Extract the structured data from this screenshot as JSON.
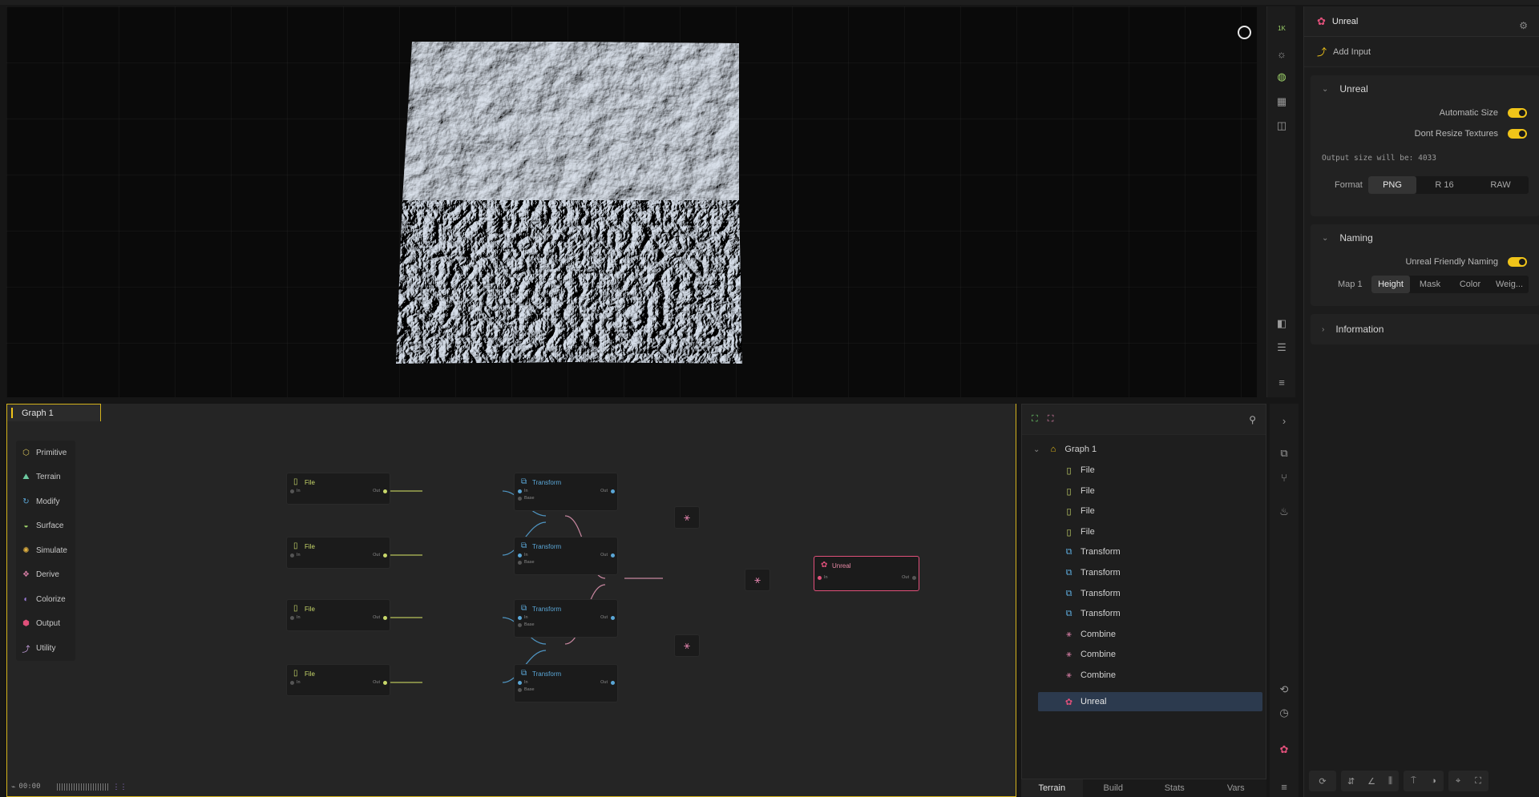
{
  "viewport": {
    "resolution_badge": "1K"
  },
  "right_panel": {
    "title": "Unreal",
    "add_input": "Add Input",
    "unreal_section": {
      "title": "Unreal",
      "automatic_size": "Automatic Size",
      "dont_resize": "Dont Resize Textures",
      "output_size": "Output size will be: 4033",
      "format_label": "Format",
      "formats": [
        "PNG",
        "R 16",
        "RAW"
      ],
      "selected_format": "PNG"
    },
    "naming_section": {
      "title": "Naming",
      "friendly": "Unreal Friendly Naming",
      "map_label": "Map 1",
      "maps": [
        "Height",
        "Mask",
        "Color",
        "Weig..."
      ],
      "selected_map": "Height"
    },
    "information": "Information"
  },
  "graph": {
    "tab": "Graph 1",
    "palette": [
      "Primitive",
      "Terrain",
      "Modify",
      "Surface",
      "Simulate",
      "Derive",
      "Colorize",
      "Output",
      "Utility"
    ],
    "node_labels": {
      "file": "File",
      "transform": "Transform",
      "unreal": "Unreal",
      "in": "In",
      "out": "Out",
      "base": "Base"
    },
    "timeline": "00:00"
  },
  "tree": {
    "root": "Graph 1",
    "items": [
      "File",
      "File",
      "File",
      "File",
      "Transform",
      "Transform",
      "Transform",
      "Transform",
      "Combine",
      "Combine",
      "Combine",
      "Unreal"
    ],
    "selected": "Unreal"
  },
  "bottom_tabs": [
    "Terrain",
    "Build",
    "Stats",
    "Vars"
  ],
  "colors": {
    "accent": "#f0c419",
    "file": "#c8d86a",
    "transform": "#5aa6d6",
    "combine": "#d07aa0",
    "unreal": "#e0507a"
  }
}
